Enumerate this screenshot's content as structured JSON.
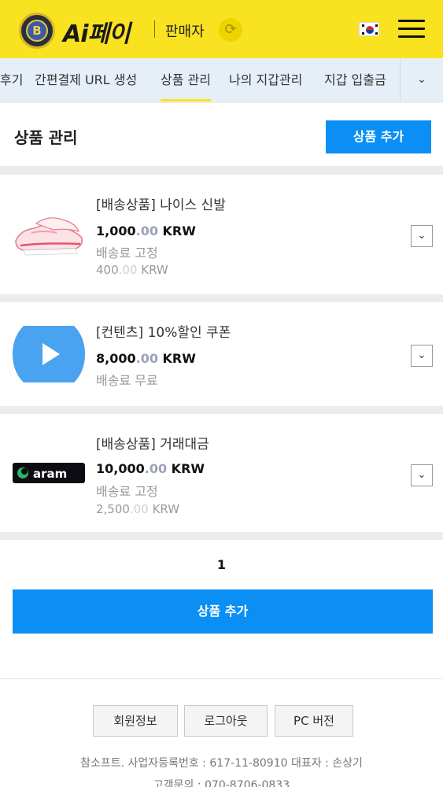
{
  "header": {
    "logo_coin_letter": "B",
    "logo_text": "Ai페이",
    "role_label": "판매자",
    "refresh_icon": "refresh-icon",
    "flag_icon": "korea-flag-icon",
    "menu_icon": "hamburger-menu-icon",
    "accent_color": "#f9e21f"
  },
  "tabs": {
    "items": [
      {
        "label": "후기"
      },
      {
        "label": "간편결제 URL 생성"
      },
      {
        "label": "상품 관리"
      },
      {
        "label": "나의 지갑관리"
      },
      {
        "label": "지갑 입출금"
      }
    ],
    "active_label": "상품 관리",
    "more_icon": "chevron-down-icon"
  },
  "page": {
    "title": "상품 관리",
    "add_button": "상품 추가",
    "button_color": "#0b8ff5"
  },
  "products": [
    {
      "name": "[배송상품] 나이스 신발",
      "price_int": "1,000",
      "price_dec": ".00",
      "currency": "KRW",
      "shipping": "배송료 고정",
      "fee_int": "400",
      "fee_dec": ".00",
      "fee_currency": "KRW",
      "thumb_icon": "sneaker-image"
    },
    {
      "name": "[컨텐츠] 10%할인 쿠폰",
      "price_int": "8,000",
      "price_dec": ".00",
      "currency": "KRW",
      "shipping": "배송료 무료",
      "thumb_icon": "play-icon"
    },
    {
      "name": "[배송상품] 거래대금",
      "price_int": "10,000",
      "price_dec": ".00",
      "currency": "KRW",
      "shipping": "배송료 고정",
      "fee_int": "2,500",
      "fee_dec": ".00",
      "fee_currency": "KRW",
      "thumb_text": "aram",
      "thumb_icon": "aram-logo"
    }
  ],
  "pagination": {
    "current_page": "1"
  },
  "bottom": {
    "add_button": "상품 추가"
  },
  "footer": {
    "buttons": [
      {
        "label": "회원정보"
      },
      {
        "label": "로그아웃"
      },
      {
        "label": "PC 버전"
      }
    ],
    "company_line": "참소프트.  사업자등록번호 : 617-11-80910   대표자 : 손상기",
    "contact_line": "고객문의 : 070-8706-0833"
  }
}
